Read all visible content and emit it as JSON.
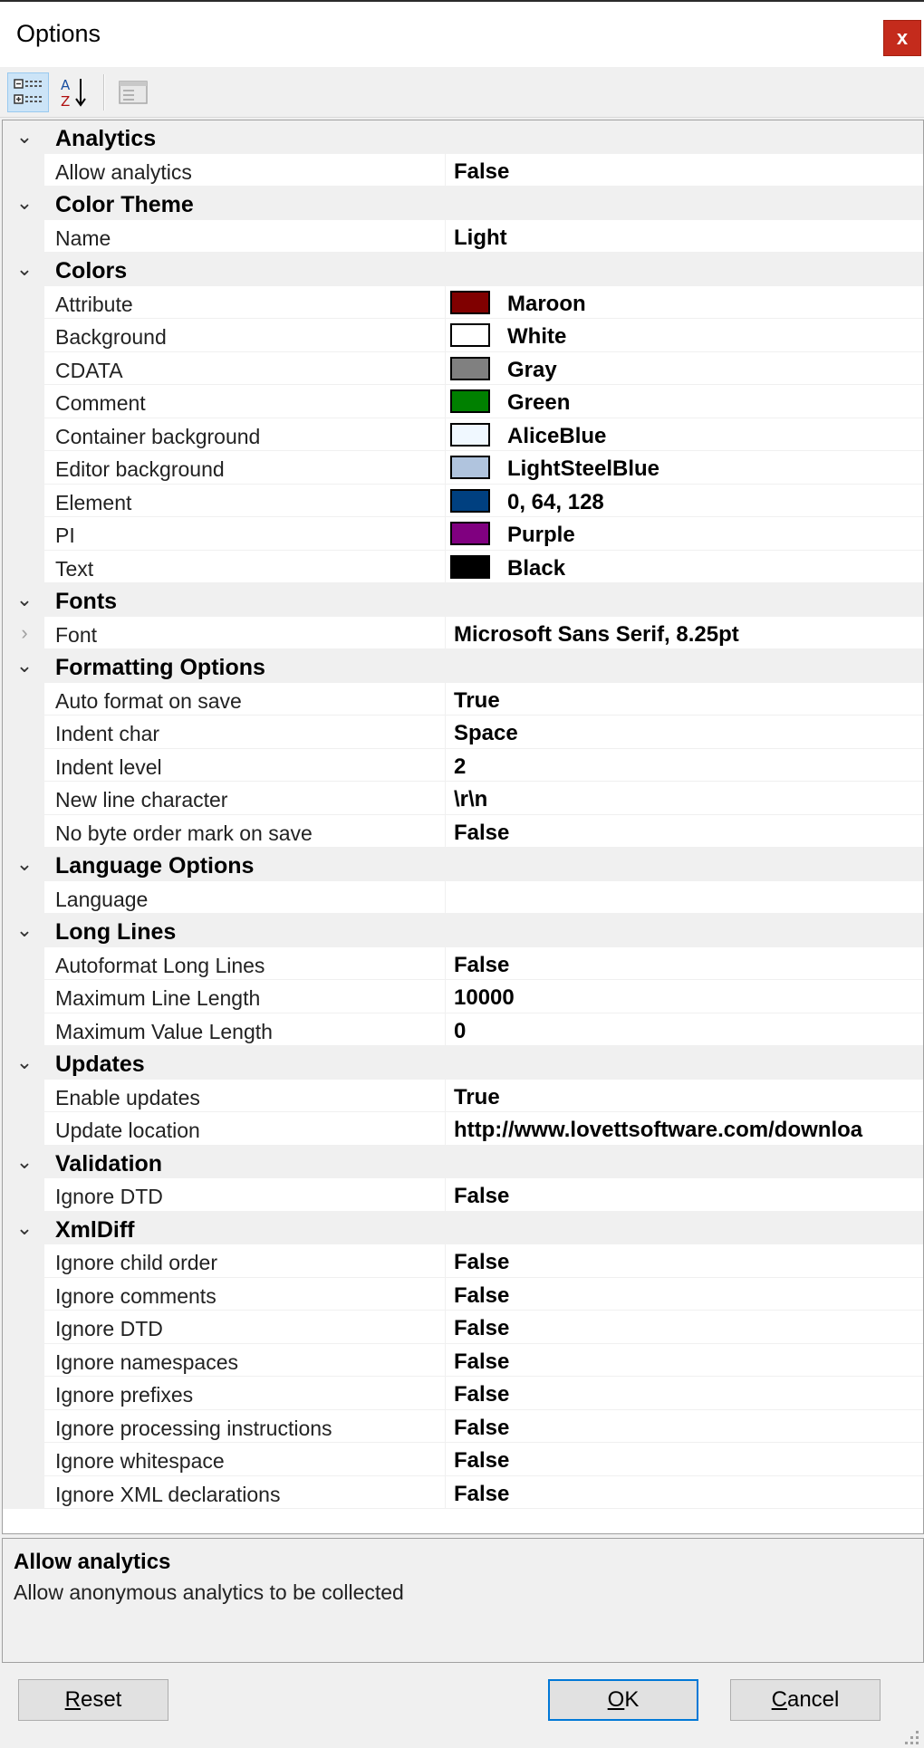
{
  "window": {
    "title": "Options",
    "close_glyph": "x"
  },
  "toolbar": {
    "categorized_icon": "categorized-view-icon",
    "alphabetical_icon": "alphabetical-sort-icon",
    "property_pages_icon": "property-pages-icon"
  },
  "grid": {
    "rows": [
      {
        "type": "category",
        "label": "Analytics"
      },
      {
        "type": "prop",
        "name": "Allow analytics",
        "value": "False"
      },
      {
        "type": "category",
        "label": "Color Theme"
      },
      {
        "type": "prop",
        "name": "Name",
        "value": "Light"
      },
      {
        "type": "category",
        "label": "Colors"
      },
      {
        "type": "prop",
        "name": "Attribute",
        "value": "Maroon",
        "swatch": "#800000"
      },
      {
        "type": "prop",
        "name": "Background",
        "value": "White",
        "swatch": "#ffffff"
      },
      {
        "type": "prop",
        "name": "CDATA",
        "value": "Gray",
        "swatch": "#808080"
      },
      {
        "type": "prop",
        "name": "Comment",
        "value": "Green",
        "swatch": "#008000"
      },
      {
        "type": "prop",
        "name": "Container background",
        "value": "AliceBlue",
        "swatch": "#f0f8ff"
      },
      {
        "type": "prop",
        "name": "Editor background",
        "value": "LightSteelBlue",
        "swatch": "#b0c4de"
      },
      {
        "type": "prop",
        "name": "Element",
        "value": "0, 64, 128",
        "swatch": "#004080"
      },
      {
        "type": "prop",
        "name": "PI",
        "value": "Purple",
        "swatch": "#800080"
      },
      {
        "type": "prop",
        "name": "Text",
        "value": "Black",
        "swatch": "#000000"
      },
      {
        "type": "category",
        "label": "Fonts"
      },
      {
        "type": "prop",
        "name": "Font",
        "value": "Microsoft Sans Serif, 8.25pt",
        "expandable": true
      },
      {
        "type": "category",
        "label": "Formatting Options"
      },
      {
        "type": "prop",
        "name": "Auto format on save",
        "value": "True"
      },
      {
        "type": "prop",
        "name": "Indent char",
        "value": "Space"
      },
      {
        "type": "prop",
        "name": "Indent level",
        "value": "2"
      },
      {
        "type": "prop",
        "name": "New line character",
        "value": "\\r\\n"
      },
      {
        "type": "prop",
        "name": "No byte order mark on save",
        "value": "False"
      },
      {
        "type": "category",
        "label": "Language Options"
      },
      {
        "type": "prop",
        "name": "Language",
        "value": ""
      },
      {
        "type": "category",
        "label": "Long Lines"
      },
      {
        "type": "prop",
        "name": "Autoformat Long Lines",
        "value": "False"
      },
      {
        "type": "prop",
        "name": "Maximum Line Length",
        "value": "10000"
      },
      {
        "type": "prop",
        "name": "Maximum Value Length",
        "value": "0"
      },
      {
        "type": "category",
        "label": "Updates"
      },
      {
        "type": "prop",
        "name": "Enable updates",
        "value": "True"
      },
      {
        "type": "prop",
        "name": "Update location",
        "value": "http://www.lovettsoftware.com/downloa"
      },
      {
        "type": "category",
        "label": "Validation"
      },
      {
        "type": "prop",
        "name": "Ignore DTD",
        "value": "False"
      },
      {
        "type": "category",
        "label": "XmlDiff"
      },
      {
        "type": "prop",
        "name": "Ignore child order",
        "value": "False"
      },
      {
        "type": "prop",
        "name": "Ignore comments",
        "value": "False"
      },
      {
        "type": "prop",
        "name": "Ignore DTD",
        "value": "False"
      },
      {
        "type": "prop",
        "name": "Ignore namespaces",
        "value": "False"
      },
      {
        "type": "prop",
        "name": "Ignore prefixes",
        "value": "False"
      },
      {
        "type": "prop",
        "name": "Ignore processing instructions",
        "value": "False"
      },
      {
        "type": "prop",
        "name": "Ignore whitespace",
        "value": "False"
      },
      {
        "type": "prop",
        "name": "Ignore XML declarations",
        "value": "False"
      }
    ]
  },
  "description": {
    "title": "Allow analytics",
    "text": "Allow anonymous analytics to be collected"
  },
  "buttons": {
    "reset_accel": "R",
    "reset_rest": "eset",
    "ok_accel": "O",
    "ok_rest": "K",
    "cancel_accel": "C",
    "cancel_rest": "ancel"
  }
}
